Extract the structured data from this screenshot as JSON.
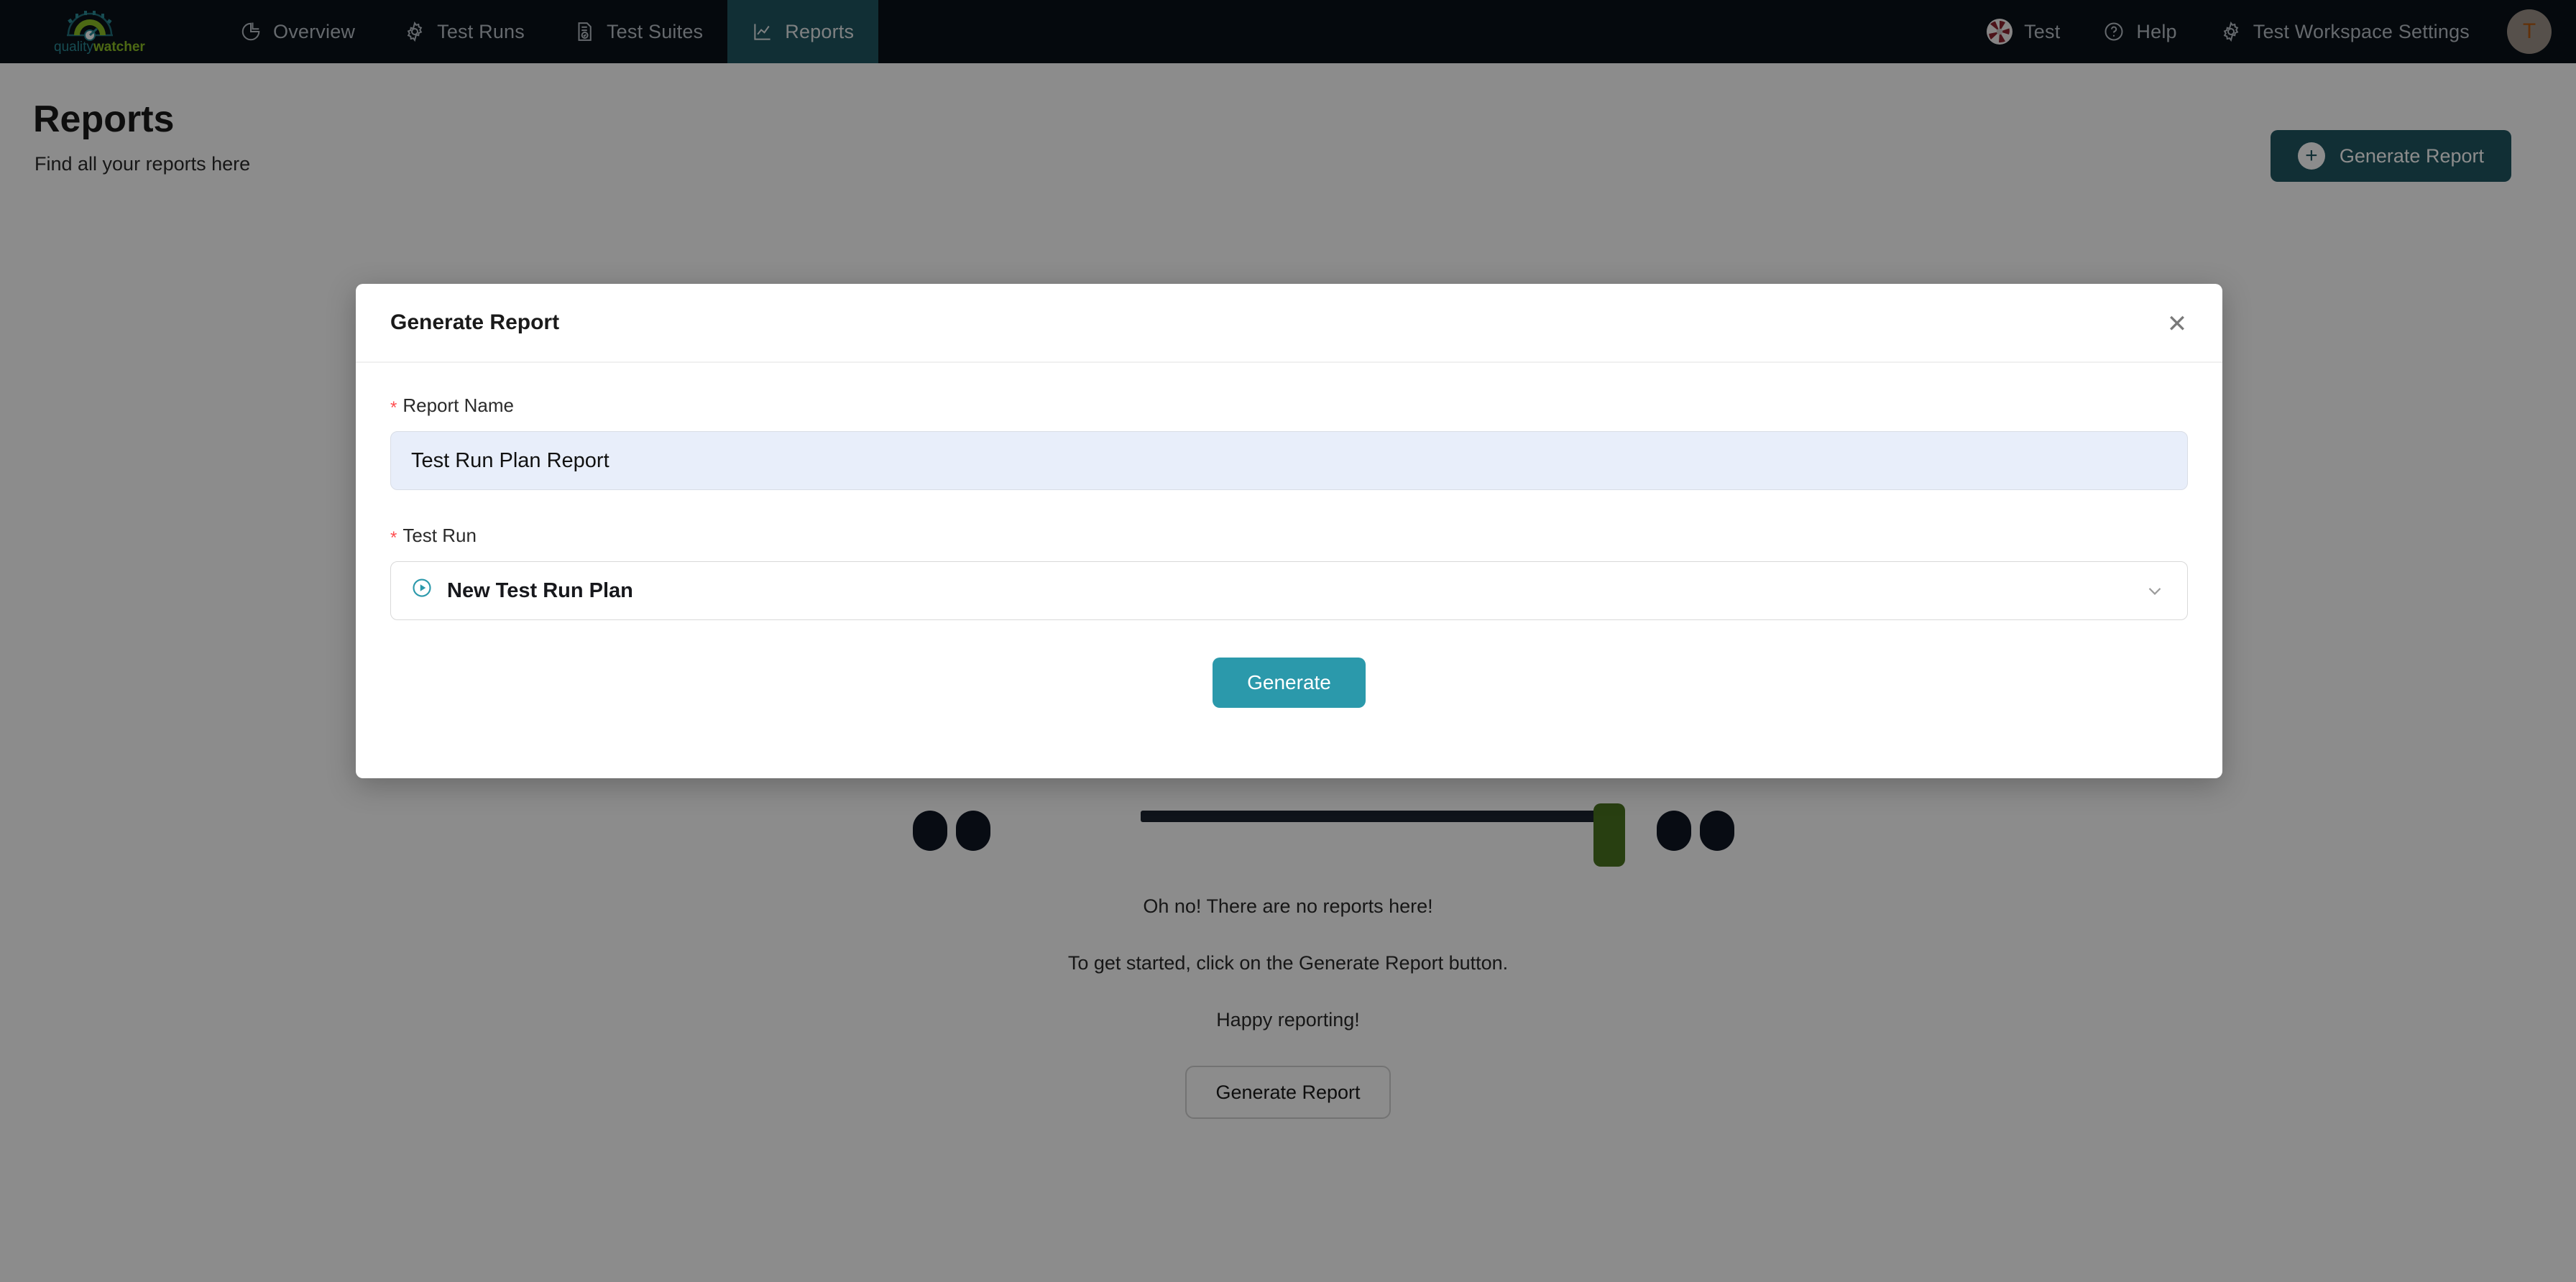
{
  "nav": {
    "brand": {
      "text_light": "quality",
      "text_bold": "watcher",
      "icon": "gauge-logo"
    },
    "left_items": [
      {
        "label": "Overview",
        "icon": "pie-chart-icon",
        "active": false
      },
      {
        "label": "Test Runs",
        "icon": "gear-icon",
        "active": false
      },
      {
        "label": "Test Suites",
        "icon": "document-check-icon",
        "active": false
      },
      {
        "label": "Reports",
        "icon": "line-chart-icon",
        "active": true
      }
    ],
    "right_items": [
      {
        "label": "Test",
        "icon": "workspace-logo-icon"
      },
      {
        "label": "Help",
        "icon": "question-circle-icon"
      },
      {
        "label": "Test Workspace Settings",
        "icon": "gear-icon"
      }
    ],
    "avatar": {
      "initial": "T"
    }
  },
  "page": {
    "title": "Reports",
    "subtitle": "Find all your reports here",
    "generate_button": "Generate Report",
    "generate_button_icon": "plus-circle-icon"
  },
  "empty_state": {
    "line1": "Oh no! There are no reports here!",
    "line2": "To get started, click on the Generate Report button.",
    "line3": "Happy reporting!",
    "button": "Generate Report"
  },
  "modal": {
    "title": "Generate Report",
    "close_icon": "close-icon",
    "report_name": {
      "label": "Report Name",
      "required_marker": "*",
      "value": "Test Run Plan Report",
      "placeholder": "Report Name"
    },
    "test_run": {
      "label": "Test Run",
      "required_marker": "*",
      "value": "New Test Run Plan",
      "value_icon": "play-circle-icon",
      "chevron_icon": "chevron-down-icon"
    },
    "submit_button": "Generate"
  },
  "colors": {
    "nav_bg": "#0a1119",
    "nav_active": "#1f5661",
    "accent_teal": "#2b99ab",
    "brand_green": "#8cbf26",
    "required_red": "#ff4d4f",
    "input_autofill": "#e8eefa"
  }
}
